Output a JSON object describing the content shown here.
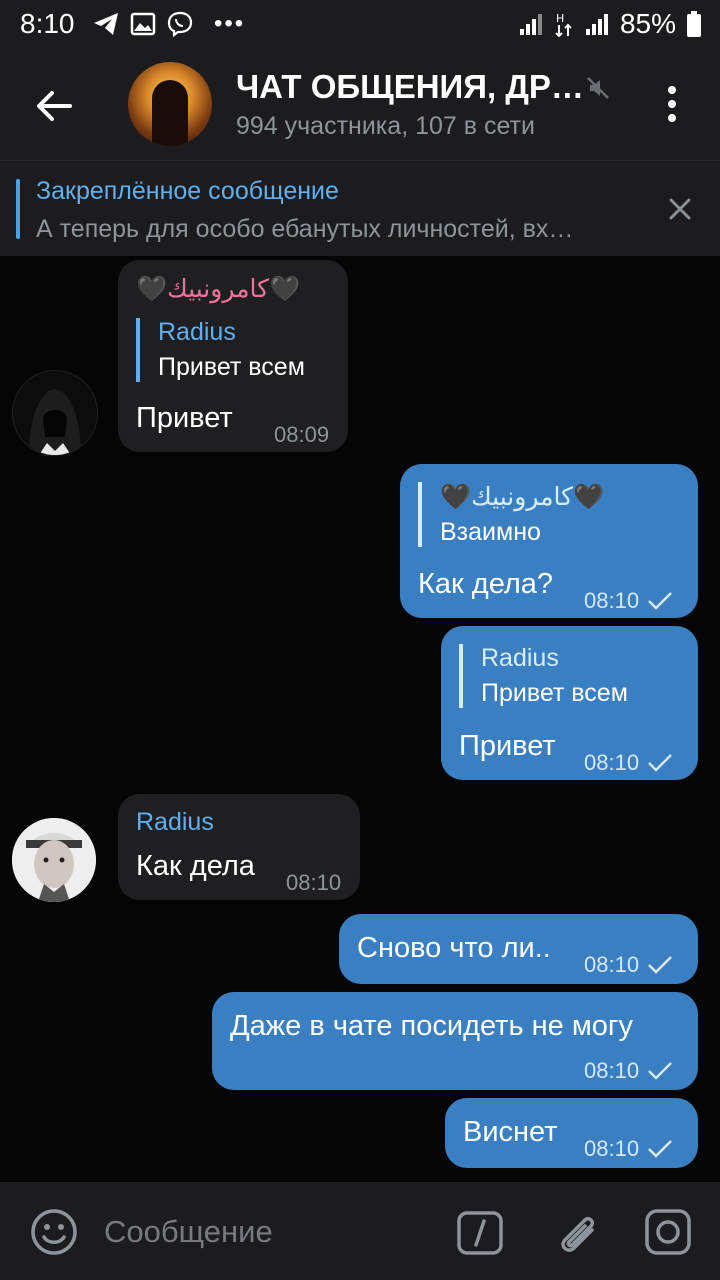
{
  "status": {
    "time": "8:10",
    "battery": "85%",
    "icons": [
      "telegram-icon",
      "gallery-icon",
      "viber-icon",
      "more-dots-icon",
      "signal-icon",
      "data-icon",
      "signal-icon",
      "battery-icon"
    ]
  },
  "header": {
    "title": "ЧАТ ОБЩЕНИЯ, ДР…",
    "subtitle": "994 участника, 107 в сети"
  },
  "pinned": {
    "title": "Закреплённое сообщение",
    "text": "А теперь для особо ебанутых личностей, вх…"
  },
  "messages": [
    {
      "dir": "in",
      "sender": "🖤كامرونبيك🖤",
      "reply_sender": "Radius",
      "reply_text": "Привет всем",
      "text": "Привет",
      "time": "08:09"
    },
    {
      "dir": "out",
      "reply_sender": "🖤كامرونبيك🖤",
      "reply_text": "Взаимно",
      "text": "Как дела?",
      "time": "08:10"
    },
    {
      "dir": "out",
      "reply_sender": "Radius",
      "reply_text": "Привет всем",
      "text": "Привет",
      "time": "08:10"
    },
    {
      "dir": "in",
      "sender": "Radius",
      "text": "Как дела",
      "time": "08:10"
    },
    {
      "dir": "out",
      "text": "Сново что ли..",
      "time": "08:10"
    },
    {
      "dir": "out",
      "text": "Даже в чате посидеть не могу",
      "time": "08:10"
    },
    {
      "dir": "out",
      "text": "Виснет",
      "time": "08:10"
    }
  ],
  "composer": {
    "placeholder": "Сообщение"
  },
  "colors": {
    "accent": "#5eb0f0",
    "outgoing": "#3a7fc1",
    "incoming": "#1f1f21",
    "header": "#1c1c1e",
    "sender_pink": "#f0729a"
  }
}
